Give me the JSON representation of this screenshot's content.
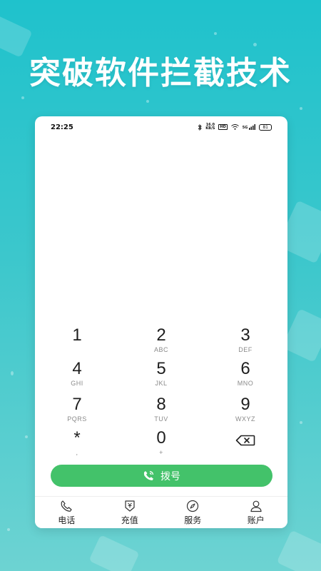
{
  "headline": "突破软件拦截技术",
  "status_bar": {
    "time": "22:25",
    "speed_value": "16.0",
    "speed_unit": "KB/S",
    "hd": "HD",
    "network": "5G",
    "battery": "81"
  },
  "keypad": [
    [
      {
        "digit": "1",
        "letters": ""
      },
      {
        "digit": "2",
        "letters": "ABC"
      },
      {
        "digit": "3",
        "letters": "DEF"
      }
    ],
    [
      {
        "digit": "4",
        "letters": "GHI"
      },
      {
        "digit": "5",
        "letters": "JKL"
      },
      {
        "digit": "6",
        "letters": "MNO"
      }
    ],
    [
      {
        "digit": "7",
        "letters": "PQRS"
      },
      {
        "digit": "8",
        "letters": "TUV"
      },
      {
        "digit": "9",
        "letters": "WXYZ"
      }
    ],
    [
      {
        "digit": "*",
        "letters": ","
      },
      {
        "digit": "0",
        "letters": "+"
      },
      {
        "digit": "",
        "letters": ""
      }
    ]
  ],
  "call_button": {
    "label": "拨号"
  },
  "tabs": [
    {
      "label": "电话",
      "icon": "phone-icon"
    },
    {
      "label": "充值",
      "icon": "recharge-icon"
    },
    {
      "label": "服务",
      "icon": "compass-icon"
    },
    {
      "label": "账户",
      "icon": "user-icon"
    }
  ],
  "colors": {
    "background": "#1fc2cc",
    "call_button": "#43c26a",
    "accent_text": "#ffffff"
  }
}
